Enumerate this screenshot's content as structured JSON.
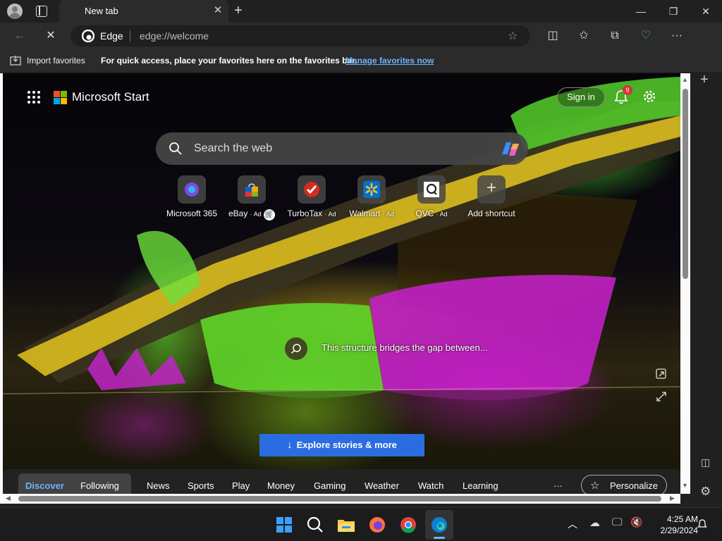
{
  "browser": {
    "tab_title": "New tab",
    "omnibox": {
      "site_label": "Edge",
      "url": "edge://welcome"
    }
  },
  "favorites_bar": {
    "import_label": "Import favorites",
    "message": "For quick access, place your favorites here on the favorites bar.",
    "link": "Manage favorites now"
  },
  "page": {
    "brand": "Microsoft Start",
    "signin_label": "Sign in",
    "notification_count": "9",
    "search_placeholder": "Search the web",
    "shortcuts": [
      {
        "label": "Microsoft 365",
        "ad": ""
      },
      {
        "label": "eBay",
        "ad": "· Ad"
      },
      {
        "label": "TurboTax",
        "ad": "· Ad"
      },
      {
        "label": "Walmart",
        "ad": "· Ad"
      },
      {
        "label": "QVC",
        "ad": "· Ad"
      },
      {
        "label": "Add shortcut",
        "ad": ""
      }
    ],
    "caption": "This structure bridges the gap between...",
    "explore_label": "Explore stories & more",
    "nav": [
      "Discover",
      "Following",
      "News",
      "Sports",
      "Play",
      "Money",
      "Gaming",
      "Weather",
      "Watch",
      "Learning"
    ],
    "more_label": "···",
    "personalize_label": "Personalize"
  },
  "taskbar": {
    "time": "4:25 AM",
    "date": "2/29/2024"
  },
  "colors": {
    "accent": "#2b6de0",
    "link": "#6cb4ff",
    "active_nav": "#6cb4ff"
  }
}
